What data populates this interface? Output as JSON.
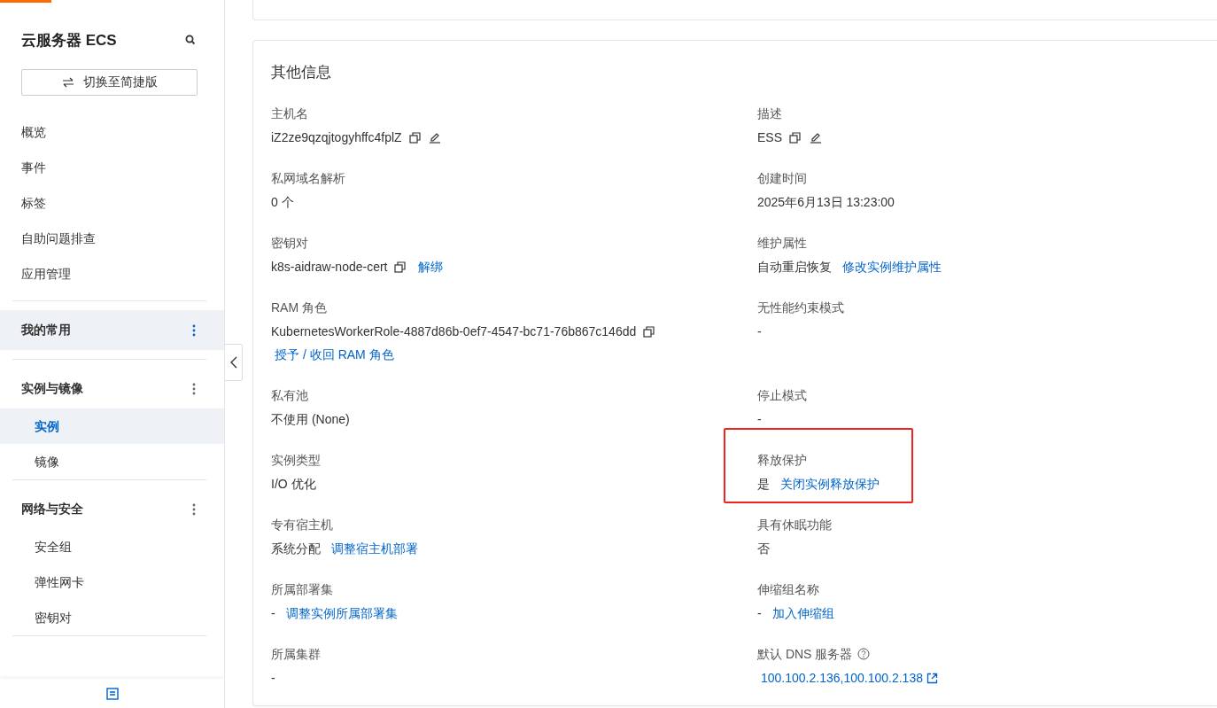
{
  "progress": {
    "level": 0.042
  },
  "sidebar": {
    "title": "云服务器 ECS",
    "switch_button": "切换至简捷版",
    "nav_items": [
      {
        "label": "概览",
        "selected": false
      },
      {
        "label": "事件",
        "selected": false
      },
      {
        "label": "标签",
        "selected": false
      },
      {
        "label": "自助问题排查",
        "selected": false
      },
      {
        "label": "应用管理",
        "selected": false
      }
    ],
    "groups": [
      {
        "title": "我的常用",
        "highlighted": true
      },
      {
        "title": "实例与镜像",
        "highlighted": false,
        "items": [
          {
            "label": "实例",
            "selected": true
          },
          {
            "label": "镜像",
            "selected": false
          }
        ]
      },
      {
        "title": "网络与安全",
        "highlighted": false,
        "items": [
          {
            "label": "安全组",
            "selected": false
          },
          {
            "label": "弹性网卡",
            "selected": false
          },
          {
            "label": "密钥对",
            "selected": false
          }
        ]
      }
    ]
  },
  "card": {
    "title": "其他信息",
    "fields": [
      {
        "label": "主机名",
        "value": "iZ2ze9qzqjtogyhffc4fplZ",
        "copyable": true,
        "editable": true
      },
      {
        "label": "描述",
        "value": "ESS",
        "copyable": true,
        "editable": true
      },
      {
        "label": "私网域名解析",
        "value": "0 个"
      },
      {
        "label": "创建时间",
        "value": "2025年6月13日 13:23:00"
      },
      {
        "label": "密钥对",
        "value": "k8s-aidraw-node-cert",
        "copyable": true,
        "link": "解绑"
      },
      {
        "label": "维护属性",
        "value": "自动重启恢复",
        "link": "修改实例维护属性"
      },
      {
        "label": "RAM 角色",
        "value": "KubernetesWorkerRole-4887d86b-0ef7-4547-bc71-76b867c146dd",
        "copyable": true,
        "link": [
          "授予",
          "/ 收回 RAM 角色"
        ]
      },
      {
        "label": "无性能约束模式",
        "value": "-"
      },
      {
        "label": "私有池",
        "value": "不使用 (None)"
      },
      {
        "label": "停止模式",
        "value": "-"
      },
      {
        "label": "实例类型",
        "value": "I/O 优化"
      },
      {
        "label": "释放保护",
        "value": "是",
        "link": "关闭实例释放保护",
        "highlighted": true
      },
      {
        "label": "专有宿主机",
        "value": "系统分配",
        "link": "调整宿主机部署"
      },
      {
        "label": "具有休眠功能",
        "value": "否"
      },
      {
        "label": "所属部署集",
        "value": "-",
        "link": "调整实例所属部署集"
      },
      {
        "label": "伸缩组名称",
        "value": "-",
        "link": "加入伸缩组"
      },
      {
        "label": "所属集群",
        "value": "-"
      },
      {
        "label": "默认 DNS 服务器",
        "help": true,
        "link": "100.100.2.136,100.100.2.138",
        "external": true
      }
    ]
  }
}
